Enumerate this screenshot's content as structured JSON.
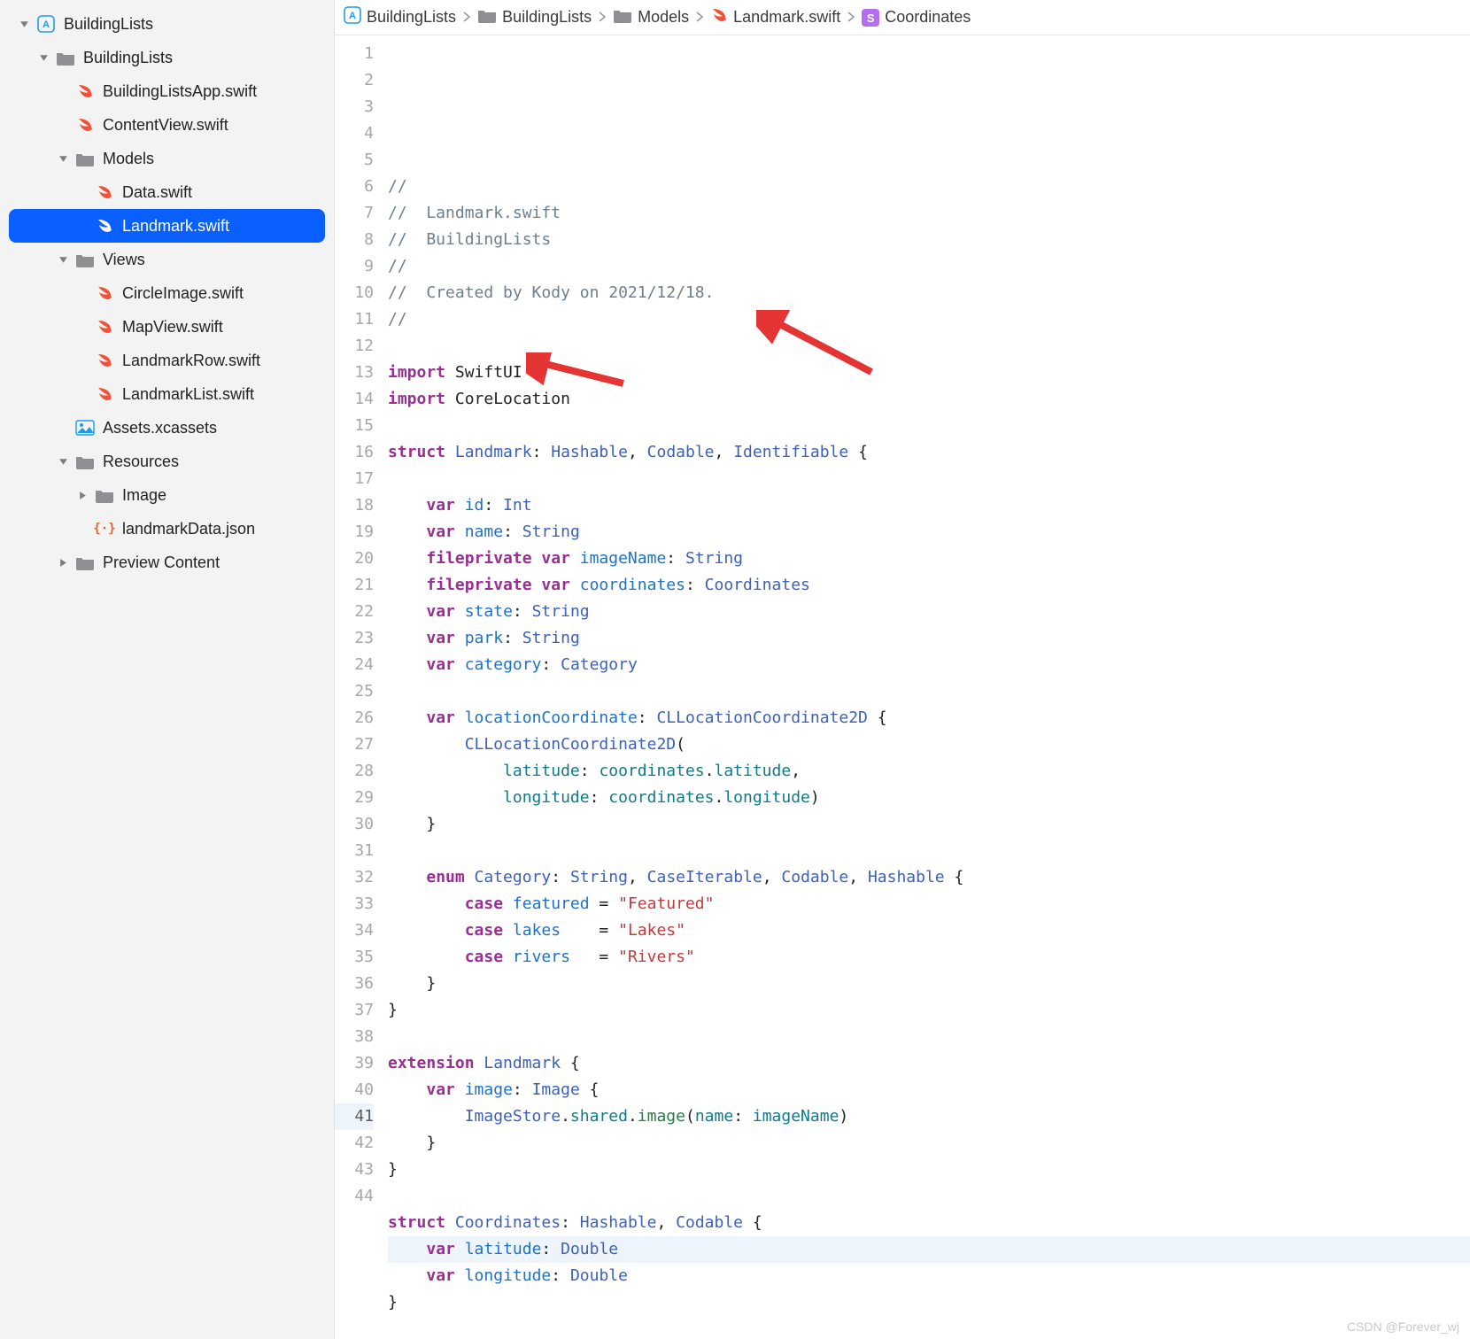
{
  "breadcrumb": [
    {
      "icon": "app",
      "label": "BuildingLists"
    },
    {
      "icon": "folder",
      "label": "BuildingLists"
    },
    {
      "icon": "folder",
      "label": "Models"
    },
    {
      "icon": "swift",
      "label": "Landmark.swift"
    },
    {
      "icon": "struct",
      "label": "Coordinates"
    }
  ],
  "sidebar": {
    "tree": [
      {
        "depth": 0,
        "chev": "down",
        "icon": "app",
        "label": "BuildingLists"
      },
      {
        "depth": 1,
        "chev": "down",
        "icon": "folder",
        "label": "BuildingLists"
      },
      {
        "depth": 2,
        "chev": "",
        "icon": "swift",
        "label": "BuildingListsApp.swift"
      },
      {
        "depth": 2,
        "chev": "",
        "icon": "swift",
        "label": "ContentView.swift"
      },
      {
        "depth": 2,
        "chev": "down",
        "icon": "folder",
        "label": "Models"
      },
      {
        "depth": 3,
        "chev": "",
        "icon": "swift",
        "label": "Data.swift"
      },
      {
        "depth": 3,
        "chev": "",
        "icon": "swift",
        "label": "Landmark.swift",
        "selected": true
      },
      {
        "depth": 2,
        "chev": "down",
        "icon": "folder",
        "label": "Views"
      },
      {
        "depth": 3,
        "chev": "",
        "icon": "swift",
        "label": "CircleImage.swift"
      },
      {
        "depth": 3,
        "chev": "",
        "icon": "swift",
        "label": "MapView.swift"
      },
      {
        "depth": 3,
        "chev": "",
        "icon": "swift",
        "label": "LandmarkRow.swift"
      },
      {
        "depth": 3,
        "chev": "",
        "icon": "swift",
        "label": "LandmarkList.swift"
      },
      {
        "depth": 2,
        "chev": "",
        "icon": "assets",
        "label": "Assets.xcassets"
      },
      {
        "depth": 2,
        "chev": "down",
        "icon": "folder",
        "label": "Resources"
      },
      {
        "depth": 3,
        "chev": "right",
        "icon": "folder",
        "label": "Image"
      },
      {
        "depth": 3,
        "chev": "",
        "icon": "json",
        "label": "landmarkData.json"
      },
      {
        "depth": 2,
        "chev": "right",
        "icon": "folder",
        "label": "Preview Content"
      }
    ]
  },
  "code": {
    "lines": [
      [
        {
          "t": "//",
          "c": "comment"
        }
      ],
      [
        {
          "t": "//  Landmark.swift",
          "c": "comment"
        }
      ],
      [
        {
          "t": "//  BuildingLists",
          "c": "comment"
        }
      ],
      [
        {
          "t": "//",
          "c": "comment"
        }
      ],
      [
        {
          "t": "//  Created by Kody on 2021/12/18.",
          "c": "comment"
        }
      ],
      [
        {
          "t": "//",
          "c": "comment"
        }
      ],
      [],
      [
        {
          "t": "import ",
          "c": "kw"
        },
        {
          "t": "SwiftUI",
          "c": "dark"
        }
      ],
      [
        {
          "t": "import ",
          "c": "kw"
        },
        {
          "t": "CoreLocation",
          "c": "dark"
        }
      ],
      [],
      [
        {
          "t": "struct ",
          "c": "kw"
        },
        {
          "t": "Landmark",
          "c": "type"
        },
        {
          "t": ": ",
          "c": "punc"
        },
        {
          "t": "Hashable",
          "c": "type"
        },
        {
          "t": ", ",
          "c": "punc"
        },
        {
          "t": "Codable",
          "c": "type"
        },
        {
          "t": ", ",
          "c": "punc"
        },
        {
          "t": "Identifiable",
          "c": "type"
        },
        {
          "t": " {",
          "c": "punc"
        }
      ],
      [],
      [
        {
          "t": "    ",
          "c": "punc"
        },
        {
          "t": "var ",
          "c": "kw"
        },
        {
          "t": "id",
          "c": "id"
        },
        {
          "t": ": ",
          "c": "punc"
        },
        {
          "t": "Int",
          "c": "type"
        }
      ],
      [
        {
          "t": "    ",
          "c": "punc"
        },
        {
          "t": "var ",
          "c": "kw"
        },
        {
          "t": "name",
          "c": "id"
        },
        {
          "t": ": ",
          "c": "punc"
        },
        {
          "t": "String",
          "c": "type"
        }
      ],
      [
        {
          "t": "    ",
          "c": "punc"
        },
        {
          "t": "fileprivate var ",
          "c": "kw"
        },
        {
          "t": "imageName",
          "c": "id"
        },
        {
          "t": ": ",
          "c": "punc"
        },
        {
          "t": "String",
          "c": "type"
        }
      ],
      [
        {
          "t": "    ",
          "c": "punc"
        },
        {
          "t": "fileprivate var ",
          "c": "kw"
        },
        {
          "t": "coordinates",
          "c": "id"
        },
        {
          "t": ": ",
          "c": "punc"
        },
        {
          "t": "Coordinates",
          "c": "type"
        }
      ],
      [
        {
          "t": "    ",
          "c": "punc"
        },
        {
          "t": "var ",
          "c": "kw"
        },
        {
          "t": "state",
          "c": "id"
        },
        {
          "t": ": ",
          "c": "punc"
        },
        {
          "t": "String",
          "c": "type"
        }
      ],
      [
        {
          "t": "    ",
          "c": "punc"
        },
        {
          "t": "var ",
          "c": "kw"
        },
        {
          "t": "park",
          "c": "id"
        },
        {
          "t": ": ",
          "c": "punc"
        },
        {
          "t": "String",
          "c": "type"
        }
      ],
      [
        {
          "t": "    ",
          "c": "punc"
        },
        {
          "t": "var ",
          "c": "kw"
        },
        {
          "t": "category",
          "c": "id"
        },
        {
          "t": ": ",
          "c": "punc"
        },
        {
          "t": "Category",
          "c": "type"
        }
      ],
      [],
      [
        {
          "t": "    ",
          "c": "punc"
        },
        {
          "t": "var ",
          "c": "kw"
        },
        {
          "t": "locationCoordinate",
          "c": "id"
        },
        {
          "t": ": ",
          "c": "punc"
        },
        {
          "t": "CLLocationCoordinate2D",
          "c": "type"
        },
        {
          "t": " {",
          "c": "punc"
        }
      ],
      [
        {
          "t": "        ",
          "c": "punc"
        },
        {
          "t": "CLLocationCoordinate2D",
          "c": "type"
        },
        {
          "t": "(",
          "c": "punc"
        }
      ],
      [
        {
          "t": "            ",
          "c": "punc"
        },
        {
          "t": "latitude",
          "c": "prop"
        },
        {
          "t": ": ",
          "c": "punc"
        },
        {
          "t": "coordinates",
          "c": "prop"
        },
        {
          "t": ".",
          "c": "punc"
        },
        {
          "t": "latitude",
          "c": "prop"
        },
        {
          "t": ",",
          "c": "punc"
        }
      ],
      [
        {
          "t": "            ",
          "c": "punc"
        },
        {
          "t": "longitude",
          "c": "prop"
        },
        {
          "t": ": ",
          "c": "punc"
        },
        {
          "t": "coordinates",
          "c": "prop"
        },
        {
          "t": ".",
          "c": "punc"
        },
        {
          "t": "longitude",
          "c": "prop"
        },
        {
          "t": ")",
          "c": "punc"
        }
      ],
      [
        {
          "t": "    }",
          "c": "punc"
        }
      ],
      [],
      [
        {
          "t": "    ",
          "c": "punc"
        },
        {
          "t": "enum ",
          "c": "kw"
        },
        {
          "t": "Category",
          "c": "type"
        },
        {
          "t": ": ",
          "c": "punc"
        },
        {
          "t": "String",
          "c": "type"
        },
        {
          "t": ", ",
          "c": "punc"
        },
        {
          "t": "CaseIterable",
          "c": "type"
        },
        {
          "t": ", ",
          "c": "punc"
        },
        {
          "t": "Codable",
          "c": "type"
        },
        {
          "t": ", ",
          "c": "punc"
        },
        {
          "t": "Hashable",
          "c": "type"
        },
        {
          "t": " {",
          "c": "punc"
        }
      ],
      [
        {
          "t": "        ",
          "c": "punc"
        },
        {
          "t": "case ",
          "c": "kw"
        },
        {
          "t": "featured",
          "c": "id"
        },
        {
          "t": " = ",
          "c": "punc"
        },
        {
          "t": "\"Featured\"",
          "c": "str"
        }
      ],
      [
        {
          "t": "        ",
          "c": "punc"
        },
        {
          "t": "case ",
          "c": "kw"
        },
        {
          "t": "lakes",
          "c": "id"
        },
        {
          "t": "    = ",
          "c": "punc"
        },
        {
          "t": "\"Lakes\"",
          "c": "str"
        }
      ],
      [
        {
          "t": "        ",
          "c": "punc"
        },
        {
          "t": "case ",
          "c": "kw"
        },
        {
          "t": "rivers",
          "c": "id"
        },
        {
          "t": "   = ",
          "c": "punc"
        },
        {
          "t": "\"Rivers\"",
          "c": "str"
        }
      ],
      [
        {
          "t": "    }",
          "c": "punc"
        }
      ],
      [
        {
          "t": "}",
          "c": "punc"
        }
      ],
      [],
      [
        {
          "t": "extension ",
          "c": "ext"
        },
        {
          "t": "Landmark",
          "c": "type"
        },
        {
          "t": " {",
          "c": "punc"
        }
      ],
      [
        {
          "t": "    ",
          "c": "punc"
        },
        {
          "t": "var ",
          "c": "kw"
        },
        {
          "t": "image",
          "c": "id"
        },
        {
          "t": ": ",
          "c": "punc"
        },
        {
          "t": "Image",
          "c": "type"
        },
        {
          "t": " {",
          "c": "punc"
        }
      ],
      [
        {
          "t": "        ",
          "c": "punc"
        },
        {
          "t": "ImageStore",
          "c": "type"
        },
        {
          "t": ".",
          "c": "punc"
        },
        {
          "t": "shared",
          "c": "prop"
        },
        {
          "t": ".",
          "c": "punc"
        },
        {
          "t": "image",
          "c": "func"
        },
        {
          "t": "(",
          "c": "punc"
        },
        {
          "t": "name",
          "c": "prop"
        },
        {
          "t": ": ",
          "c": "punc"
        },
        {
          "t": "imageName",
          "c": "prop"
        },
        {
          "t": ")",
          "c": "punc"
        }
      ],
      [
        {
          "t": "    }",
          "c": "punc"
        }
      ],
      [
        {
          "t": "}",
          "c": "punc"
        }
      ],
      [],
      [
        {
          "t": "struct ",
          "c": "kw"
        },
        {
          "t": "Coordinates",
          "c": "type"
        },
        {
          "t": ": ",
          "c": "punc"
        },
        {
          "t": "Hashable",
          "c": "type"
        },
        {
          "t": ", ",
          "c": "punc"
        },
        {
          "t": "Codable",
          "c": "type"
        },
        {
          "t": " {",
          "c": "punc"
        }
      ],
      [
        {
          "t": "    ",
          "c": "punc"
        },
        {
          "t": "var ",
          "c": "kw"
        },
        {
          "t": "latitude",
          "c": "id"
        },
        {
          "t": ": ",
          "c": "punc"
        },
        {
          "t": "Double",
          "c": "type"
        }
      ],
      [
        {
          "t": "    ",
          "c": "punc"
        },
        {
          "t": "var ",
          "c": "kw"
        },
        {
          "t": "longitude",
          "c": "id"
        },
        {
          "t": ": ",
          "c": "punc"
        },
        {
          "t": "Double",
          "c": "type"
        }
      ],
      [
        {
          "t": "}",
          "c": "punc"
        }
      ],
      []
    ],
    "highlighted_line": 41
  },
  "watermark": "CSDN @Forever_wj"
}
